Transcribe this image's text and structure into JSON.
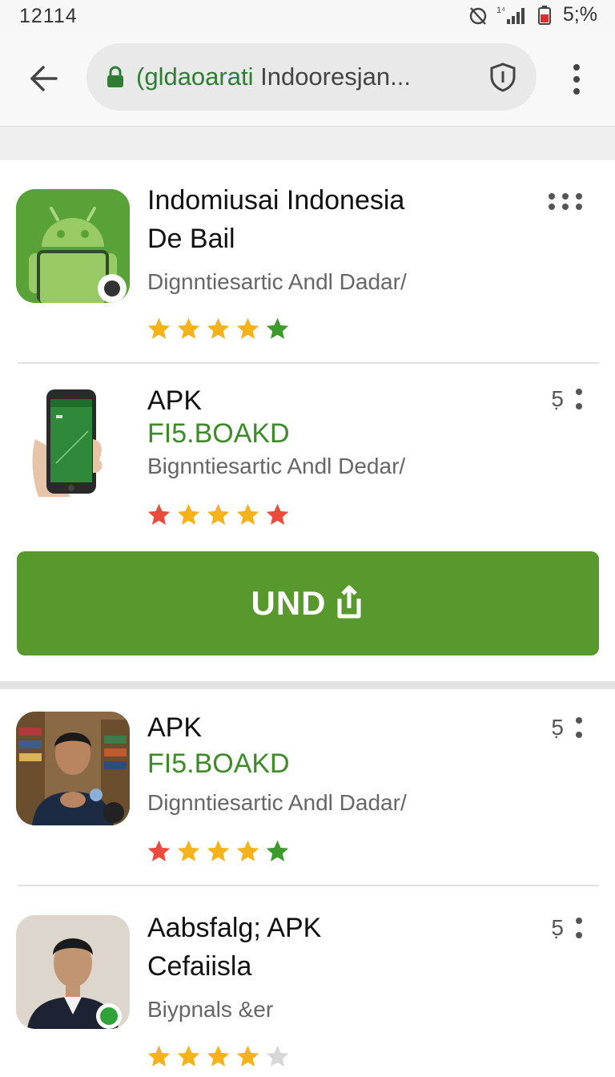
{
  "status_bar": {
    "time": "12114",
    "signal_label": "1⁴",
    "battery_pct": "5;%"
  },
  "toolbar": {
    "url_domain": "(gldaoarati",
    "url_rest": " Indooresjan...",
    "back_icon": "arrow-left-icon",
    "lock_icon": "lock-icon",
    "shield_icon": "shield-icon",
    "menu_icon": "more-vert-icon"
  },
  "apps": [
    {
      "title_line1": "Indomiusai Indonesia",
      "title_line2": "De Bail",
      "developer": "Dignntiesartic  Andl Dadar/",
      "rating": 4.5,
      "menu_label": "",
      "icon": "android-icon"
    },
    {
      "title_line1": "APK",
      "subtitle": "FI5.BOAKD",
      "developer": "Bignntiesartic  Andl Dedar/",
      "rating": 5,
      "menu_label": "5̣",
      "icon": "phone-screenshot-icon"
    },
    {
      "title_line1": "APK",
      "subtitle": "FI5.BOAKD",
      "developer": "Dignntiesartic  Andl Dadar/",
      "rating": 4.5,
      "menu_label": "5̣",
      "icon": "person-avatar-icon"
    },
    {
      "title_line1": "Aabsfalg; APK",
      "title_line2": "Cefaiisla",
      "developer": "Biypnals &er",
      "rating": 4,
      "menu_label": "5̣",
      "icon": "person-avatar-icon"
    }
  ],
  "install_button": {
    "label": "UND",
    "icon": "share-upload-icon"
  },
  "colors": {
    "accent_green": "#57992d",
    "domain_green": "#2e7d32",
    "star_gold": "#f6b21b",
    "star_red": "#ea4b3c",
    "star_green": "#3c9b2c"
  }
}
